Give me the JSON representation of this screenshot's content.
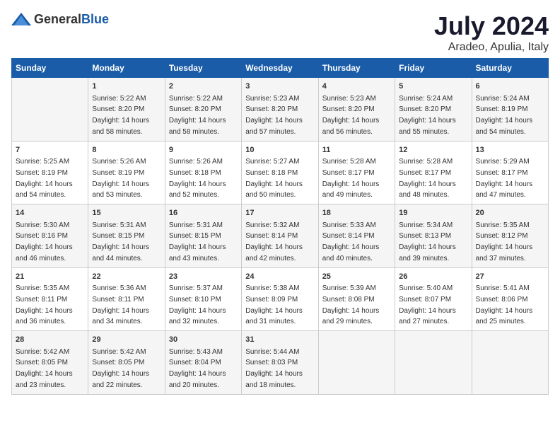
{
  "logo": {
    "general": "General",
    "blue": "Blue"
  },
  "title": "July 2024",
  "subtitle": "Aradeo, Apulia, Italy",
  "headers": [
    "Sunday",
    "Monday",
    "Tuesday",
    "Wednesday",
    "Thursday",
    "Friday",
    "Saturday"
  ],
  "weeks": [
    [
      {
        "day": "",
        "sunrise": "",
        "sunset": "",
        "daylight": ""
      },
      {
        "day": "1",
        "sunrise": "Sunrise: 5:22 AM",
        "sunset": "Sunset: 8:20 PM",
        "daylight": "Daylight: 14 hours and 58 minutes."
      },
      {
        "day": "2",
        "sunrise": "Sunrise: 5:22 AM",
        "sunset": "Sunset: 8:20 PM",
        "daylight": "Daylight: 14 hours and 58 minutes."
      },
      {
        "day": "3",
        "sunrise": "Sunrise: 5:23 AM",
        "sunset": "Sunset: 8:20 PM",
        "daylight": "Daylight: 14 hours and 57 minutes."
      },
      {
        "day": "4",
        "sunrise": "Sunrise: 5:23 AM",
        "sunset": "Sunset: 8:20 PM",
        "daylight": "Daylight: 14 hours and 56 minutes."
      },
      {
        "day": "5",
        "sunrise": "Sunrise: 5:24 AM",
        "sunset": "Sunset: 8:20 PM",
        "daylight": "Daylight: 14 hours and 55 minutes."
      },
      {
        "day": "6",
        "sunrise": "Sunrise: 5:24 AM",
        "sunset": "Sunset: 8:19 PM",
        "daylight": "Daylight: 14 hours and 54 minutes."
      }
    ],
    [
      {
        "day": "7",
        "sunrise": "Sunrise: 5:25 AM",
        "sunset": "Sunset: 8:19 PM",
        "daylight": "Daylight: 14 hours and 54 minutes."
      },
      {
        "day": "8",
        "sunrise": "Sunrise: 5:26 AM",
        "sunset": "Sunset: 8:19 PM",
        "daylight": "Daylight: 14 hours and 53 minutes."
      },
      {
        "day": "9",
        "sunrise": "Sunrise: 5:26 AM",
        "sunset": "Sunset: 8:18 PM",
        "daylight": "Daylight: 14 hours and 52 minutes."
      },
      {
        "day": "10",
        "sunrise": "Sunrise: 5:27 AM",
        "sunset": "Sunset: 8:18 PM",
        "daylight": "Daylight: 14 hours and 50 minutes."
      },
      {
        "day": "11",
        "sunrise": "Sunrise: 5:28 AM",
        "sunset": "Sunset: 8:17 PM",
        "daylight": "Daylight: 14 hours and 49 minutes."
      },
      {
        "day": "12",
        "sunrise": "Sunrise: 5:28 AM",
        "sunset": "Sunset: 8:17 PM",
        "daylight": "Daylight: 14 hours and 48 minutes."
      },
      {
        "day": "13",
        "sunrise": "Sunrise: 5:29 AM",
        "sunset": "Sunset: 8:17 PM",
        "daylight": "Daylight: 14 hours and 47 minutes."
      }
    ],
    [
      {
        "day": "14",
        "sunrise": "Sunrise: 5:30 AM",
        "sunset": "Sunset: 8:16 PM",
        "daylight": "Daylight: 14 hours and 46 minutes."
      },
      {
        "day": "15",
        "sunrise": "Sunrise: 5:31 AM",
        "sunset": "Sunset: 8:15 PM",
        "daylight": "Daylight: 14 hours and 44 minutes."
      },
      {
        "day": "16",
        "sunrise": "Sunrise: 5:31 AM",
        "sunset": "Sunset: 8:15 PM",
        "daylight": "Daylight: 14 hours and 43 minutes."
      },
      {
        "day": "17",
        "sunrise": "Sunrise: 5:32 AM",
        "sunset": "Sunset: 8:14 PM",
        "daylight": "Daylight: 14 hours and 42 minutes."
      },
      {
        "day": "18",
        "sunrise": "Sunrise: 5:33 AM",
        "sunset": "Sunset: 8:14 PM",
        "daylight": "Daylight: 14 hours and 40 minutes."
      },
      {
        "day": "19",
        "sunrise": "Sunrise: 5:34 AM",
        "sunset": "Sunset: 8:13 PM",
        "daylight": "Daylight: 14 hours and 39 minutes."
      },
      {
        "day": "20",
        "sunrise": "Sunrise: 5:35 AM",
        "sunset": "Sunset: 8:12 PM",
        "daylight": "Daylight: 14 hours and 37 minutes."
      }
    ],
    [
      {
        "day": "21",
        "sunrise": "Sunrise: 5:35 AM",
        "sunset": "Sunset: 8:11 PM",
        "daylight": "Daylight: 14 hours and 36 minutes."
      },
      {
        "day": "22",
        "sunrise": "Sunrise: 5:36 AM",
        "sunset": "Sunset: 8:11 PM",
        "daylight": "Daylight: 14 hours and 34 minutes."
      },
      {
        "day": "23",
        "sunrise": "Sunrise: 5:37 AM",
        "sunset": "Sunset: 8:10 PM",
        "daylight": "Daylight: 14 hours and 32 minutes."
      },
      {
        "day": "24",
        "sunrise": "Sunrise: 5:38 AM",
        "sunset": "Sunset: 8:09 PM",
        "daylight": "Daylight: 14 hours and 31 minutes."
      },
      {
        "day": "25",
        "sunrise": "Sunrise: 5:39 AM",
        "sunset": "Sunset: 8:08 PM",
        "daylight": "Daylight: 14 hours and 29 minutes."
      },
      {
        "day": "26",
        "sunrise": "Sunrise: 5:40 AM",
        "sunset": "Sunset: 8:07 PM",
        "daylight": "Daylight: 14 hours and 27 minutes."
      },
      {
        "day": "27",
        "sunrise": "Sunrise: 5:41 AM",
        "sunset": "Sunset: 8:06 PM",
        "daylight": "Daylight: 14 hours and 25 minutes."
      }
    ],
    [
      {
        "day": "28",
        "sunrise": "Sunrise: 5:42 AM",
        "sunset": "Sunset: 8:05 PM",
        "daylight": "Daylight: 14 hours and 23 minutes."
      },
      {
        "day": "29",
        "sunrise": "Sunrise: 5:42 AM",
        "sunset": "Sunset: 8:05 PM",
        "daylight": "Daylight: 14 hours and 22 minutes."
      },
      {
        "day": "30",
        "sunrise": "Sunrise: 5:43 AM",
        "sunset": "Sunset: 8:04 PM",
        "daylight": "Daylight: 14 hours and 20 minutes."
      },
      {
        "day": "31",
        "sunrise": "Sunrise: 5:44 AM",
        "sunset": "Sunset: 8:03 PM",
        "daylight": "Daylight: 14 hours and 18 minutes."
      },
      {
        "day": "",
        "sunrise": "",
        "sunset": "",
        "daylight": ""
      },
      {
        "day": "",
        "sunrise": "",
        "sunset": "",
        "daylight": ""
      },
      {
        "day": "",
        "sunrise": "",
        "sunset": "",
        "daylight": ""
      }
    ]
  ]
}
